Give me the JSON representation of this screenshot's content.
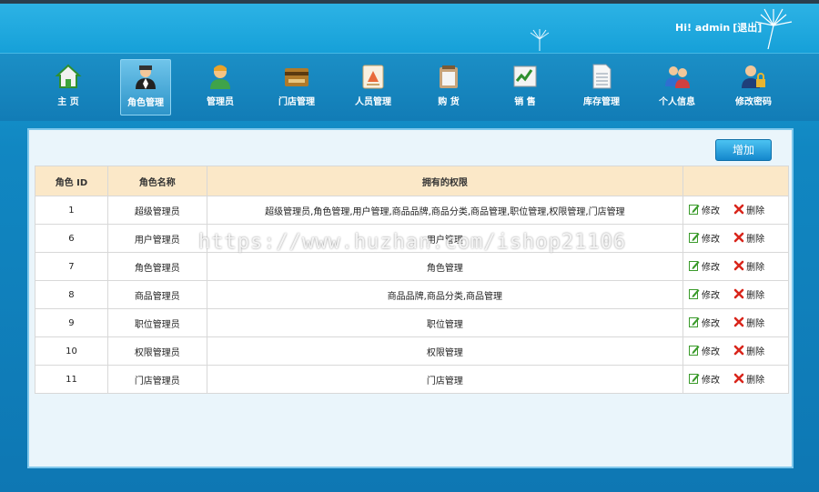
{
  "header": {
    "greeting": "Hi! admin",
    "logout_label": "[退出]"
  },
  "nav": {
    "items": [
      {
        "label": "主  页",
        "icon": "home-icon"
      },
      {
        "label": "角色管理",
        "icon": "role-icon"
      },
      {
        "label": "管理员",
        "icon": "admin-icon"
      },
      {
        "label": "门店管理",
        "icon": "store-icon"
      },
      {
        "label": "人员管理",
        "icon": "staff-icon"
      },
      {
        "label": "购  货",
        "icon": "purchase-icon"
      },
      {
        "label": "销  售",
        "icon": "sales-icon"
      },
      {
        "label": "库存管理",
        "icon": "inventory-icon"
      },
      {
        "label": "个人信息",
        "icon": "profile-icon"
      },
      {
        "label": "修改密码",
        "icon": "password-icon"
      }
    ],
    "active_index": 1
  },
  "toolbar": {
    "add_label": "增加"
  },
  "table": {
    "headers": [
      "角色 ID",
      "角色名称",
      "拥有的权限",
      ""
    ],
    "edit_label": "修改",
    "delete_label": "删除",
    "rows": [
      {
        "id": "1",
        "name": "超级管理员",
        "perms": "超级管理员,角色管理,用户管理,商品品牌,商品分类,商品管理,职位管理,权限管理,门店管理"
      },
      {
        "id": "6",
        "name": "用户管理员",
        "perms": "用户管理"
      },
      {
        "id": "7",
        "name": "角色管理员",
        "perms": "角色管理"
      },
      {
        "id": "8",
        "name": "商品管理员",
        "perms": "商品品牌,商品分类,商品管理"
      },
      {
        "id": "9",
        "name": "职位管理员",
        "perms": "职位管理"
      },
      {
        "id": "10",
        "name": "权限管理员",
        "perms": "权限管理"
      },
      {
        "id": "11",
        "name": "门店管理员",
        "perms": "门店管理"
      }
    ]
  },
  "watermark": "https://www.huzhan.com/ishop21106",
  "colors": {
    "header_bg": "#16a0d8",
    "panel_bg": "#eaf5fb",
    "table_header_bg": "#fbe8c8",
    "button_blue": "#1487cc",
    "delete_red": "#d9261c",
    "edit_green": "#3a9a2a"
  }
}
